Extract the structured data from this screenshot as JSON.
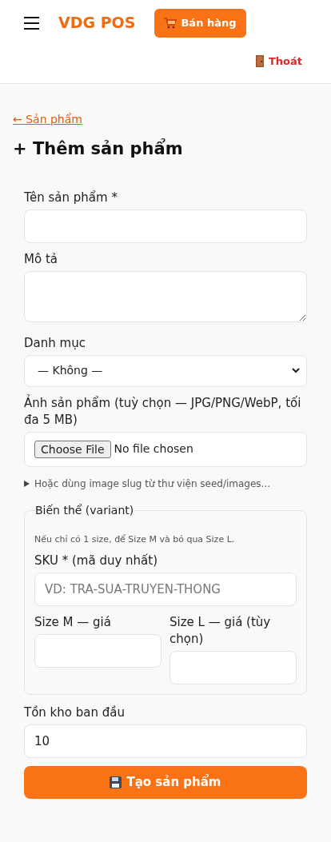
{
  "header": {
    "brand": "VDG POS",
    "sell_button": "Bán hàng",
    "logout_link": "Thoát"
  },
  "back_link": "← Sản phẩm",
  "page_title": "+ Thêm sản phẩm",
  "form": {
    "name": {
      "label": "Tên sản phẩm *"
    },
    "description": {
      "label": "Mô tả"
    },
    "category": {
      "label": "Danh mục",
      "value": "— Không —"
    },
    "image": {
      "label": "Ảnh sản phẩm (tuỳ chọn — JPG/PNG/WebP, tối đa 5 MB)",
      "button": "Choose File",
      "status": "No file chosen"
    },
    "image_slug_toggle": {
      "label": "Hoặc dùng image slug từ thư viện seed/images...",
      "expanded": false
    },
    "variant": {
      "legend": "Biến thể (variant)",
      "hint": "Nếu chỉ có 1 size, để Size M và bỏ qua Size L.",
      "sku": {
        "label": "SKU * (mã duy nhất)",
        "placeholder": "VD: TRA-SUA-TRUYEN-THONG"
      },
      "size_m": {
        "label": "Size M — giá"
      },
      "size_l": {
        "label": "Size L — giá (tùy chọn)"
      }
    },
    "initial_stock": {
      "label": "Tồn kho ban đầu",
      "value": "10"
    },
    "submit": "Tạo sản phẩm"
  }
}
